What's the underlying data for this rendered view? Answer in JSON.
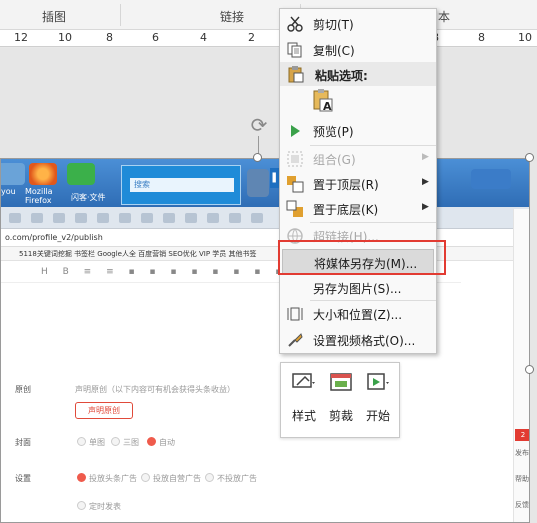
{
  "ribbon": {
    "groups": [
      "插图",
      "链接",
      "本"
    ]
  },
  "ruler": {
    "ticks_left": [
      "12",
      "10",
      "8",
      "6",
      "4",
      "2"
    ],
    "ticks_right": [
      "2",
      "4",
      "6",
      "8",
      "10"
    ]
  },
  "embedded_screenshot": {
    "desktop_labels": [
      "you",
      "Mozilla Firefox",
      "闪客·文件",
      "QQ"
    ],
    "qq_search": "搜索",
    "address": "o.com/profile_v2/publish",
    "bookmarks": "5118关键词挖掘   书签栏   Google人全   百度营销   SEO优化   VIP 学员   其他书签",
    "form": {
      "declaration_label": "原创",
      "declaration_text": "声明原创（以下内容可有机会获得头条收益）",
      "declaration_button": "声明原创",
      "cover_label": "封面",
      "cover_options": [
        "单图",
        "三图",
        "自动"
      ],
      "settings_label": "设置",
      "settings_options": [
        "投放头条广告",
        "投放自营广告",
        "不投放广告"
      ],
      "timed_publish": "定时发表"
    },
    "side_labels": [
      "发布",
      "帮助",
      "反馈"
    ],
    "side_badge": "2"
  },
  "video_toolbar": {
    "items": [
      {
        "label": "样式",
        "icon": "style-icon"
      },
      {
        "label": "剪裁",
        "icon": "trim-icon"
      },
      {
        "label": "开始",
        "icon": "start-icon"
      }
    ]
  },
  "context_menu": {
    "items": [
      {
        "label": "剪切(T)",
        "icon": "scissors-icon",
        "enabled": true,
        "submenu": false
      },
      {
        "label": "复制(C)",
        "icon": "copy-icon",
        "enabled": true,
        "submenu": false
      },
      {
        "label": "粘贴选项:",
        "icon": "paste-icon",
        "enabled": true,
        "header": true
      },
      {
        "label": "预览(P)",
        "icon": "preview-icon",
        "enabled": true,
        "submenu": false
      },
      {
        "label": "组合(G)",
        "icon": "group-icon",
        "enabled": false,
        "submenu": true
      },
      {
        "label": "置于顶层(R)",
        "icon": "bring-to-front-icon",
        "enabled": true,
        "submenu": true
      },
      {
        "label": "置于底层(K)",
        "icon": "send-to-back-icon",
        "enabled": true,
        "submenu": true
      },
      {
        "label": "超链接(H)...",
        "icon": "hyperlink-icon",
        "enabled": false,
        "submenu": false
      },
      {
        "label": "将媒体另存为(M)...",
        "icon": "",
        "enabled": true,
        "highlighted": true
      },
      {
        "label": "另存为图片(S)...",
        "icon": "",
        "enabled": true,
        "submenu": false
      },
      {
        "label": "大小和位置(Z)...",
        "icon": "size-position-icon",
        "enabled": true,
        "submenu": false
      },
      {
        "label": "设置视频格式(O)...",
        "icon": "format-video-icon",
        "enabled": true,
        "submenu": false
      }
    ],
    "paste_option_letter": "A"
  },
  "colors": {
    "highlight_box": "#e23b32",
    "accent_red": "#ef5b4c",
    "play_blue": "#1e6fc0"
  }
}
